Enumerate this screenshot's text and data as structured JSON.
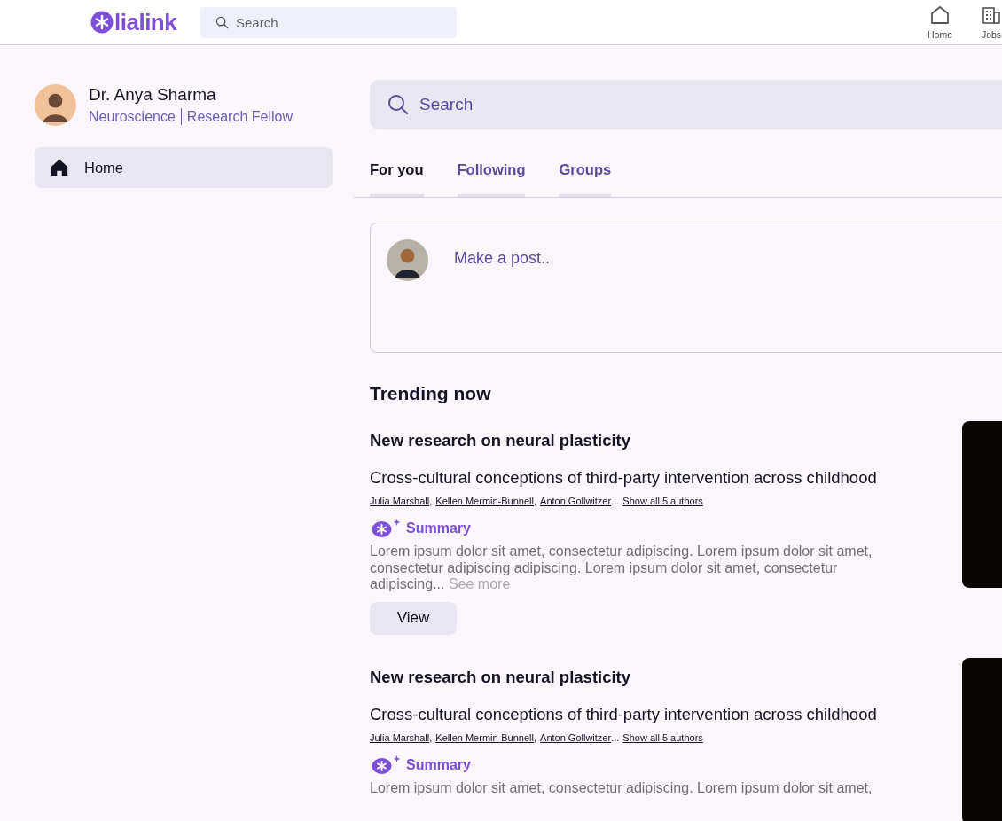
{
  "topbar": {
    "logo": "lialink",
    "search": {
      "placeholder": "Search"
    },
    "nav": [
      {
        "kind": "home",
        "label": "Home"
      },
      {
        "kind": "jobs",
        "label": "Jobs"
      }
    ]
  },
  "profile": {
    "name": "Dr. Anya Sharma",
    "field": "Neuroscience",
    "role": "Research Fellow"
  },
  "sidebar": {
    "items": [
      {
        "label": "Home",
        "selected": true
      }
    ]
  },
  "main": {
    "search": {
      "placeholder": "Search"
    },
    "tabs": [
      {
        "label": "For you",
        "selected": true
      },
      {
        "label": "Following",
        "selected": false
      },
      {
        "label": "Groups",
        "selected": false
      }
    ],
    "composer": {
      "placeholder": "Make a post.."
    },
    "section_title": "Trending now",
    "posts": [
      {
        "heading": "New research on neural plasticity",
        "title": "Cross-cultural conceptions of third-party intervention across childhood",
        "authors": [
          {
            "name": "Julia Marshall",
            "sep": ","
          },
          {
            "name": "Kellen Mermin-Bunnell",
            "sep": ","
          },
          {
            "name": "Anton Gollwitzer",
            "sep": "..."
          }
        ],
        "show_all": "Show all 5 authors",
        "summary_label": "Summary",
        "summary": "Lorem ipsum dolor sit amet, consectetur adipiscing. Lorem ipsum dolor sit amet, consectetur adipiscing adipiscing. Lorem ipsum dolor sit amet, consectetur adipiscing...",
        "see_more": "See more",
        "button": "View"
      },
      {
        "heading": "New research on neural plasticity",
        "title": "Cross-cultural conceptions of third-party intervention across childhood",
        "authors": [
          {
            "name": "Julia Marshall",
            "sep": ","
          },
          {
            "name": "Kellen Mermin-Bunnell",
            "sep": ","
          },
          {
            "name": "Anton Gollwitzer",
            "sep": "..."
          }
        ],
        "show_all": "Show all 5 authors",
        "summary_label": "Summary",
        "summary": "Lorem ipsum dolor sit amet, consectetur adipiscing. Lorem ipsum dolor sit amet,"
      }
    ]
  }
}
